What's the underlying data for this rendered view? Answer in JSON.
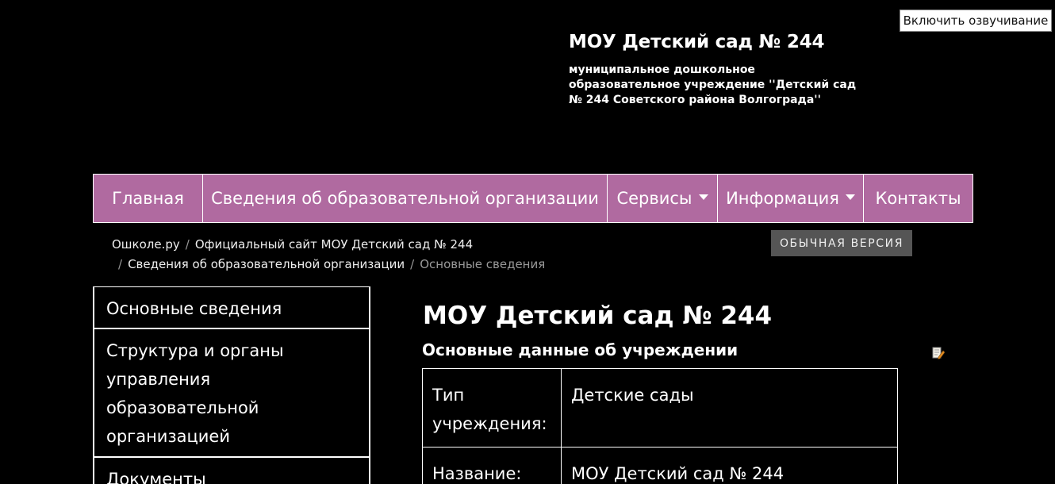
{
  "tts": {
    "label": "Включить озвучивание"
  },
  "header": {
    "title": "МОУ Детский сад № 244",
    "subtitle": "муниципальное дошкольное образовательное учреждение ''Детский сад № 244 Советского района Волгограда''"
  },
  "nav": {
    "items": [
      {
        "label": "Главная"
      },
      {
        "label": "Сведения об образовательной организации"
      },
      {
        "label": "Сервисы"
      },
      {
        "label": "Информация"
      },
      {
        "label": "Контакты"
      }
    ]
  },
  "breadcrumb": {
    "items": [
      {
        "label": "Ошколе.ру"
      },
      {
        "label": "Официальный сайт МОУ Детский сад № 244"
      },
      {
        "label": "Сведения об образовательной организации"
      },
      {
        "label": "Основные сведения"
      }
    ]
  },
  "version_button": {
    "label": "ОБЫЧНАЯ ВЕРСИЯ"
  },
  "side_menu": {
    "items": [
      {
        "label": "Основные сведения"
      },
      {
        "label": "Структура и органы управления образовательной организацией"
      },
      {
        "label": "Документы"
      }
    ]
  },
  "main": {
    "title": "МОУ Детский сад № 244",
    "subtitle": "Основные данные об учреждении",
    "rows": [
      {
        "label": "Тип учреждения:",
        "value": "Детские сады"
      },
      {
        "label": "Название:",
        "value": "МОУ Детский сад № 244"
      }
    ]
  },
  "icons": {
    "edit": "edit-note-icon"
  },
  "colors": {
    "nav_bg": "#b06aa0",
    "background": "#000000",
    "version_bg": "#555555"
  }
}
